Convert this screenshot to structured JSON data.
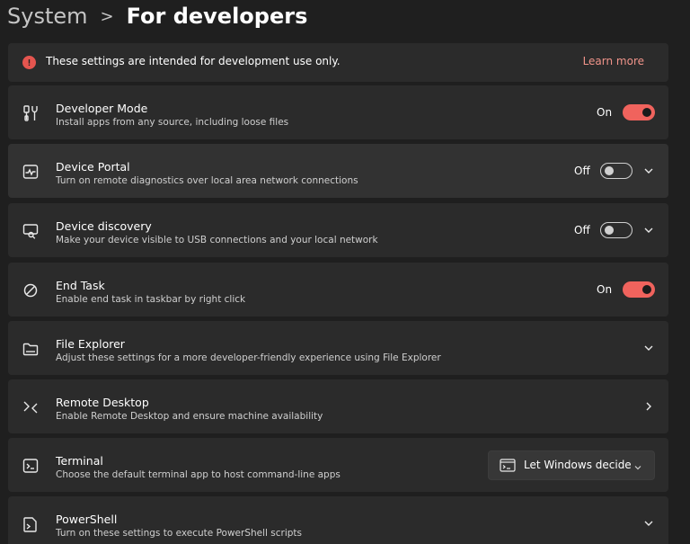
{
  "breadcrumb": {
    "parent": "System",
    "separator": ">",
    "current": "For developers"
  },
  "banner": {
    "message": "These settings are intended for development use only.",
    "link": "Learn more"
  },
  "colors": {
    "accent": "#f0635d",
    "info": "#e5554f",
    "link": "#f1948a"
  },
  "settings": [
    {
      "title": "Developer Mode",
      "description": "Install apps from any source, including loose files",
      "state": "On",
      "icon": "developer-tools-icon"
    },
    {
      "title": "Device Portal",
      "description": "Turn on remote diagnostics over local area network connections",
      "state": "Off",
      "icon": "device-portal-icon"
    },
    {
      "title": "Device discovery",
      "description": "Make your device visible to USB connections and your local network",
      "state": "Off",
      "icon": "device-discovery-icon"
    },
    {
      "title": "End Task",
      "description": "Enable end task in taskbar by right click",
      "state": "On",
      "icon": "end-task-icon"
    },
    {
      "title": "File Explorer",
      "description": "Adjust these settings for a more developer-friendly experience using File Explorer",
      "icon": "folder-icon"
    },
    {
      "title": "Remote Desktop",
      "description": "Enable Remote Desktop and ensure machine availability",
      "icon": "remote-desktop-icon"
    },
    {
      "title": "Terminal",
      "description": "Choose the default terminal app to host command-line apps",
      "dropdown_value": "Let Windows decide",
      "icon": "terminal-icon"
    },
    {
      "title": "PowerShell",
      "description": "Turn on these settings to execute PowerShell scripts",
      "icon": "powershell-icon"
    }
  ]
}
